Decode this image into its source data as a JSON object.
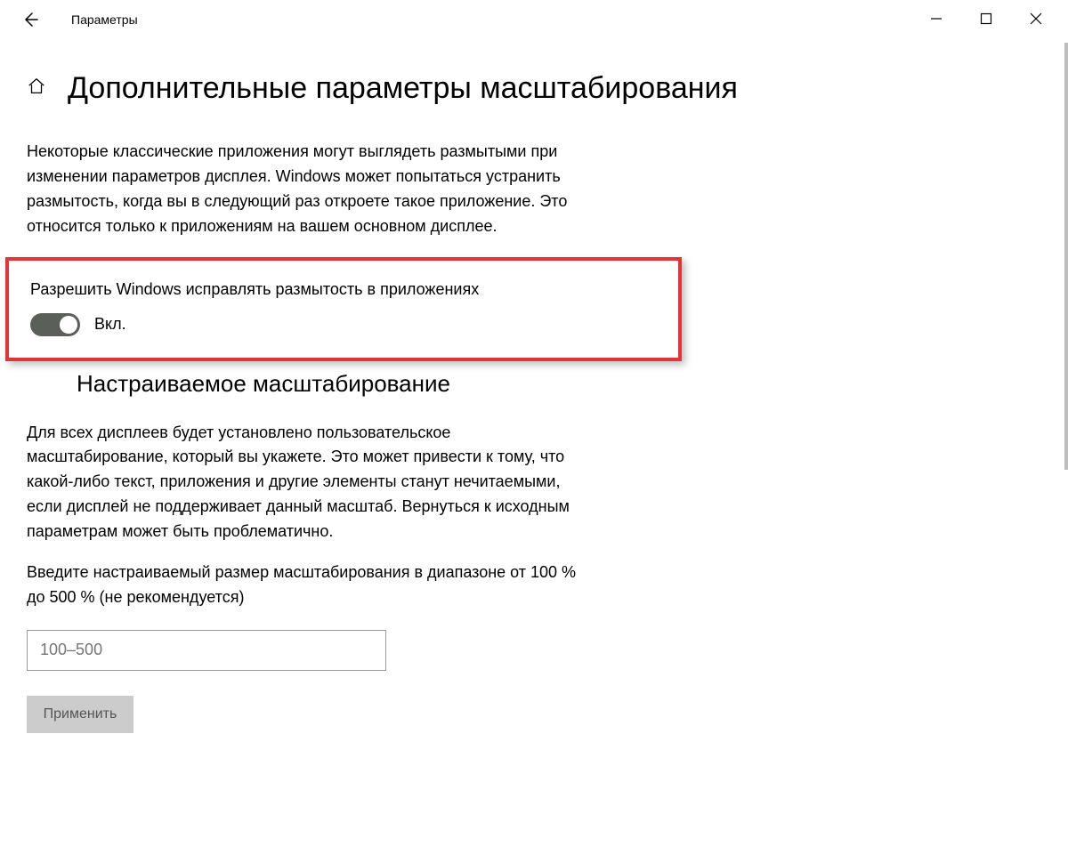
{
  "window": {
    "title": "Параметры"
  },
  "header": {
    "title": "Дополнительные параметры масштабирования"
  },
  "intro": "Некоторые классические приложения могут выглядеть размытыми при изменении параметров дисплея. Windows может попытаться устранить размытость, когда вы в следующий раз откроете такое приложение. Это относится только к приложениям на вашем основном дисплее.",
  "fix_blur": {
    "label": "Разрешить Windows исправлять размытость в приложениях",
    "state": "Вкл."
  },
  "custom_scaling": {
    "title": "Настраиваемое масштабирование",
    "desc": "Для всех дисплеев будет установлено пользовательское масштабирование, который вы укажете. Это может привести к тому, что какой-либо текст, приложения и другие элементы станут нечитаемыми, если дисплей не поддерживает данный масштаб. Вернуться к исходным параметрам может быть проблематично.",
    "input_label": "Введите настраиваемый размер масштабирования в диапазоне от 100 % до 500 % (не рекомендуется)",
    "placeholder": "100–500",
    "apply": "Применить"
  }
}
